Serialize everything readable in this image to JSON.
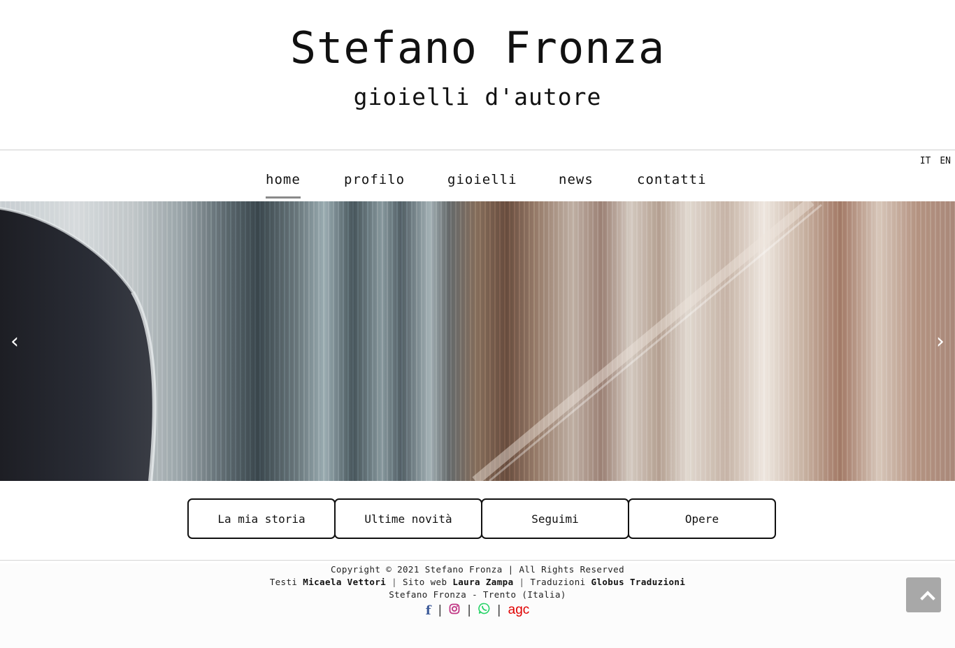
{
  "header": {
    "title": "Stefano Fronza",
    "subtitle": "gioielli d'autore"
  },
  "language": {
    "it": "IT",
    "en": "EN"
  },
  "nav": {
    "home": "home",
    "profilo": "profilo",
    "gioielli": "gioielli",
    "news": "news",
    "contatti": "contatti",
    "active": "home"
  },
  "slider": {
    "prev": "‹",
    "next": "›"
  },
  "buttons": {
    "storia": "La mia storia",
    "novita": "Ultime novità",
    "seguimi": "Seguimi",
    "opere": "Opere"
  },
  "footer": {
    "copyright": "Copyright © 2021 Stefano Fronza | All Rights Reserved",
    "testi_label": "Testi",
    "testi_name": "Micaela Vettori",
    "sito_label": "Sito web",
    "sito_name": "Laura Zampa",
    "traduzioni_label": "Traduzioni",
    "traduzioni_name": "Globus Traduzioni",
    "address": "Stefano Fronza - Trento (Italia)",
    "agc": "agc",
    "sep": "|"
  },
  "colors": {
    "facebook": "#3b5998",
    "instagram": "#c13584",
    "whatsapp": "#25d366",
    "agc": "#e00000",
    "to_top": "#a8a8a8"
  }
}
